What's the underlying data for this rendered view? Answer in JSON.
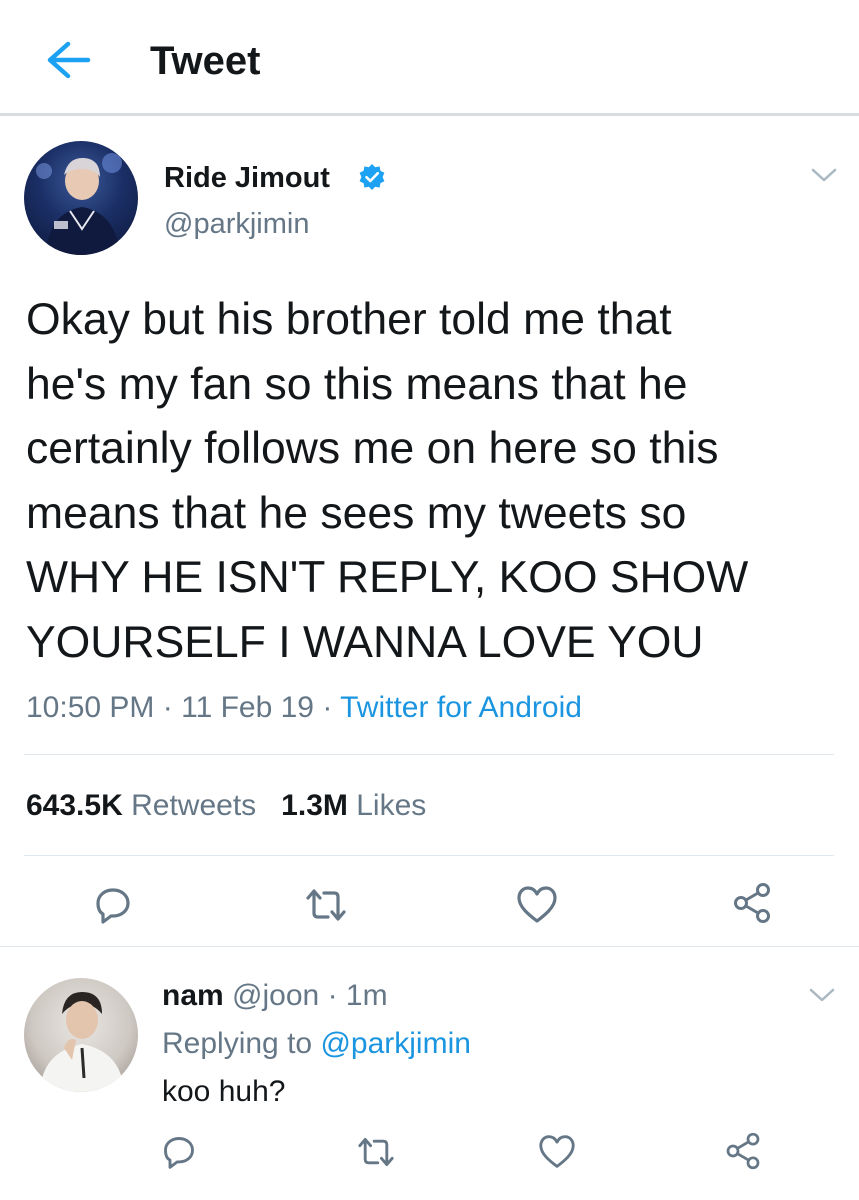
{
  "header": {
    "back_icon": "arrow-left-icon",
    "title": "Tweet",
    "accent": "#1da1f2"
  },
  "tweet": {
    "author": {
      "name": "Ride Jimout",
      "handle": "@parkjimin",
      "verified": true
    },
    "text": "Okay but his brother told me that\nhe's my fan so this means that he\ncertainly follows me on here so this\nmeans that he sees my tweets so\nWHY HE ISN'T REPLY, KOO SHOW\nYOURSELF I WANNA LOVE YOU",
    "time": "10:50 PM",
    "date": "11 Feb 19",
    "source": "Twitter for Android",
    "separator": "·",
    "retweets_count": "643.5K",
    "retweets_label": "Retweets",
    "likes_count": "1.3M",
    "likes_label": "Likes",
    "actions": [
      "reply-icon",
      "retweet-icon",
      "like-icon",
      "share-icon"
    ]
  },
  "reply": {
    "name": "nam",
    "handle": "@joon",
    "separator": "·",
    "time": "1m",
    "replying_prefix": "Replying to",
    "replying_to": "@parkjimin",
    "text": "koo huh?",
    "actions": [
      "reply-icon",
      "retweet-icon",
      "like-icon",
      "share-icon"
    ]
  },
  "colors": {
    "text": "#14171a",
    "secondary": "#657786",
    "link": "#1b95e0",
    "icon": "#657786",
    "divider": "#e1e8ed"
  }
}
